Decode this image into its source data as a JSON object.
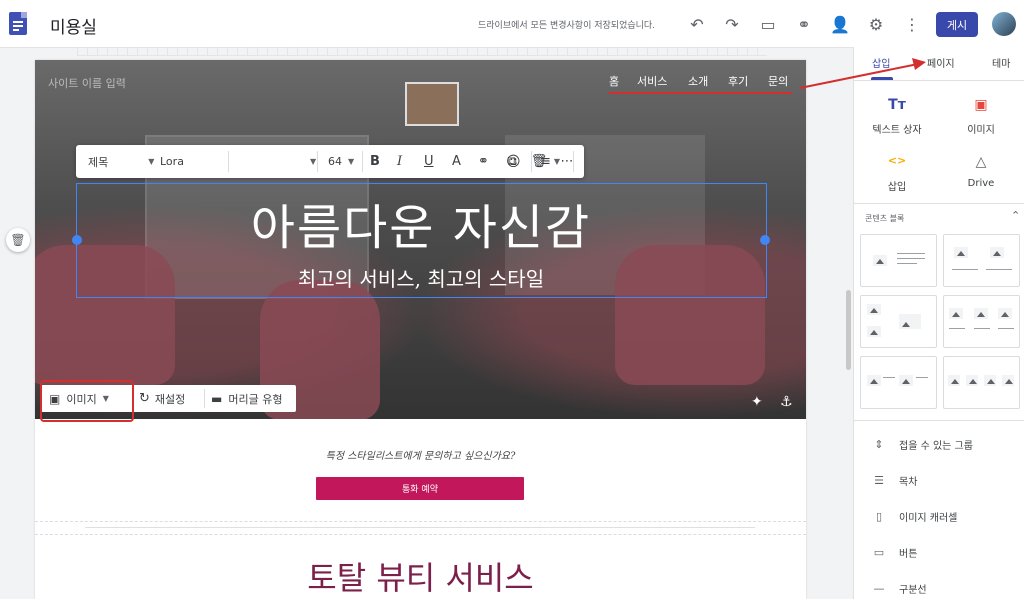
{
  "topbar": {
    "title": "미용실",
    "save_status": "드라이브에서 모든 변경사항이 저장되었습니다.",
    "publish_label": "게시",
    "icons": [
      "undo-icon",
      "redo-icon",
      "preview-device-icon",
      "link-icon",
      "share-add-person-icon",
      "settings-gear-icon",
      "more-vert-icon"
    ]
  },
  "hero": {
    "site_name_placeholder": "사이트 이름 입력",
    "nav": [
      "홈",
      "서비스",
      "소개",
      "후기",
      "문의"
    ],
    "title": "아름다운 자신감",
    "subtitle": "최고의 서비스, 최고의 스타일"
  },
  "format_toolbar": {
    "style": "제목",
    "font": "Lora",
    "size": "64"
  },
  "image_toolbar": {
    "image_label": "이미지",
    "reset_label": "재설정",
    "header_type_label": "머리글 유형"
  },
  "body": {
    "cta_question": "특정 스타일리스트에게 문의하고 싶으신가요?",
    "cta_button": "통화 예약",
    "section_title": "토탈 뷰티 서비스"
  },
  "panel": {
    "tabs": [
      "삽입",
      "페이지",
      "테마"
    ],
    "tiles": [
      {
        "label": "텍스트 상자",
        "icon": "text-box-icon",
        "glyph": "Tт"
      },
      {
        "label": "이미지",
        "icon": "image-icon",
        "glyph": "▣"
      },
      {
        "label": "삽입",
        "icon": "embed-code-icon",
        "glyph": "<>"
      },
      {
        "label": "Drive",
        "icon": "drive-icon",
        "glyph": "△"
      }
    ],
    "content_blocks_label": "콘텐츠 블록",
    "list": [
      {
        "label": "접을 수 있는 그룹",
        "glyph": "⇕"
      },
      {
        "label": "목차",
        "glyph": "☰"
      },
      {
        "label": "이미지 캐러셀",
        "glyph": "▯"
      },
      {
        "label": "버튼",
        "glyph": "▭"
      },
      {
        "label": "구분선",
        "glyph": "—"
      }
    ]
  },
  "colors": {
    "accent": "#3949ab",
    "cta": "#c2185b",
    "section_title": "#7b1f4b",
    "annotation_red": "#d32f2f",
    "selection_blue": "#4285f4"
  }
}
